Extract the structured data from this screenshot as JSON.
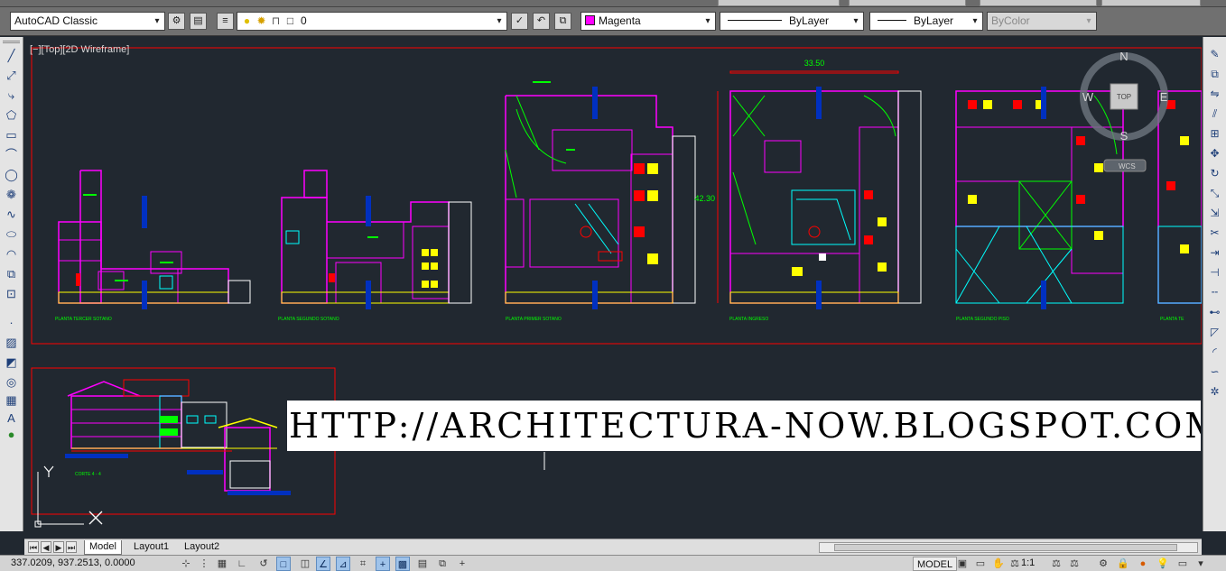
{
  "toolbar": {
    "workspace": "AutoCAD Classic",
    "layer_current": "0",
    "color": {
      "label": "Magenta",
      "swatch": "#ff00ff"
    },
    "linetype": "ByLayer",
    "lineweight": "ByLayer",
    "plot_style": "ByColor"
  },
  "viewport": {
    "label": "[−][Top][2D Wireframe]"
  },
  "viewcube": {
    "north": "N",
    "south": "S",
    "east": "E",
    "west": "W",
    "top": "TOP",
    "wcs": "WCS"
  },
  "drawing": {
    "plan_labels": [
      "PLANTA TERCER SOTANO",
      "PLANTA SEGUNDO SOTANO",
      "PLANTA PRIMER SOTANO",
      "PLANTA INGRESO",
      "PLANTA SEGUNDO PISO",
      "PLANTA TE"
    ],
    "dimension_width": "33.50",
    "dimension_height": "42.30",
    "section_label": "CORTE 4 - 4",
    "ucs_y": "Y",
    "ucs_x": "X"
  },
  "watermark": "HTTP://ARCHITECTURA-NOW.BLOGSPOT.COM/",
  "tabs": [
    "Model",
    "Layout1",
    "Layout2"
  ],
  "status": {
    "coordinates": "337.0209, 937.2513, 0.0000",
    "model_button": "MODEL",
    "annotation_scale": "1:1"
  },
  "colors": {
    "background": "#212830",
    "walls": "#ff00ff",
    "cyan": "#00ffff",
    "yellow": "#ffff00",
    "green": "#00ff00",
    "red": "#ff0000",
    "blue": "#0030c0"
  }
}
